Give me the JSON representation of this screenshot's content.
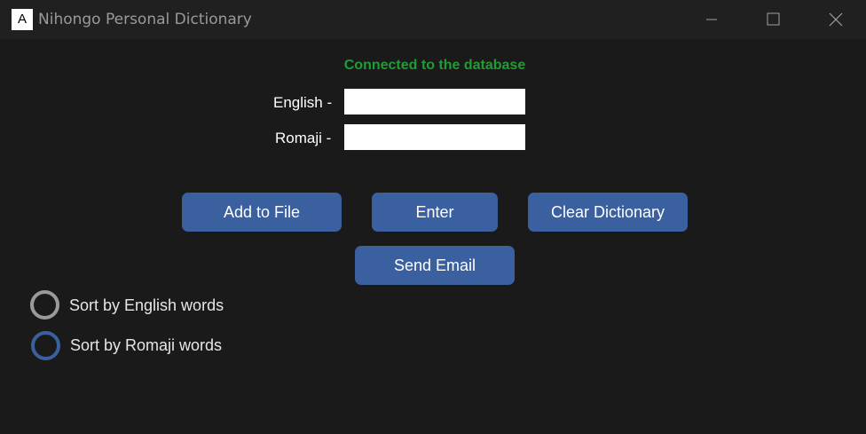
{
  "window": {
    "title": "Nihongo Personal Dictionary",
    "icon_glyph": "A",
    "icon_name": "app-icon",
    "controls": [
      "minimize-icon",
      "maximize-icon",
      "close-icon"
    ]
  },
  "status": {
    "text": "Connected to the database",
    "color": "#1f9d33"
  },
  "form": {
    "english_label": "English -",
    "english_value": "",
    "romaji_label": "Romaji -",
    "romaji_value": ""
  },
  "buttons": {
    "add_to_file": "Add to File",
    "enter": "Enter",
    "clear_dictionary": "Clear Dictionary",
    "send_email": "Send Email"
  },
  "sort_options": [
    {
      "label": "Sort by English words",
      "selected": false
    },
    {
      "label": "Sort by Romaji words",
      "selected": false
    }
  ],
  "colors": {
    "background": "#1a1a1a",
    "titlebar": "#202020",
    "accent": "#3b60a0",
    "status": "#1f9d33"
  }
}
